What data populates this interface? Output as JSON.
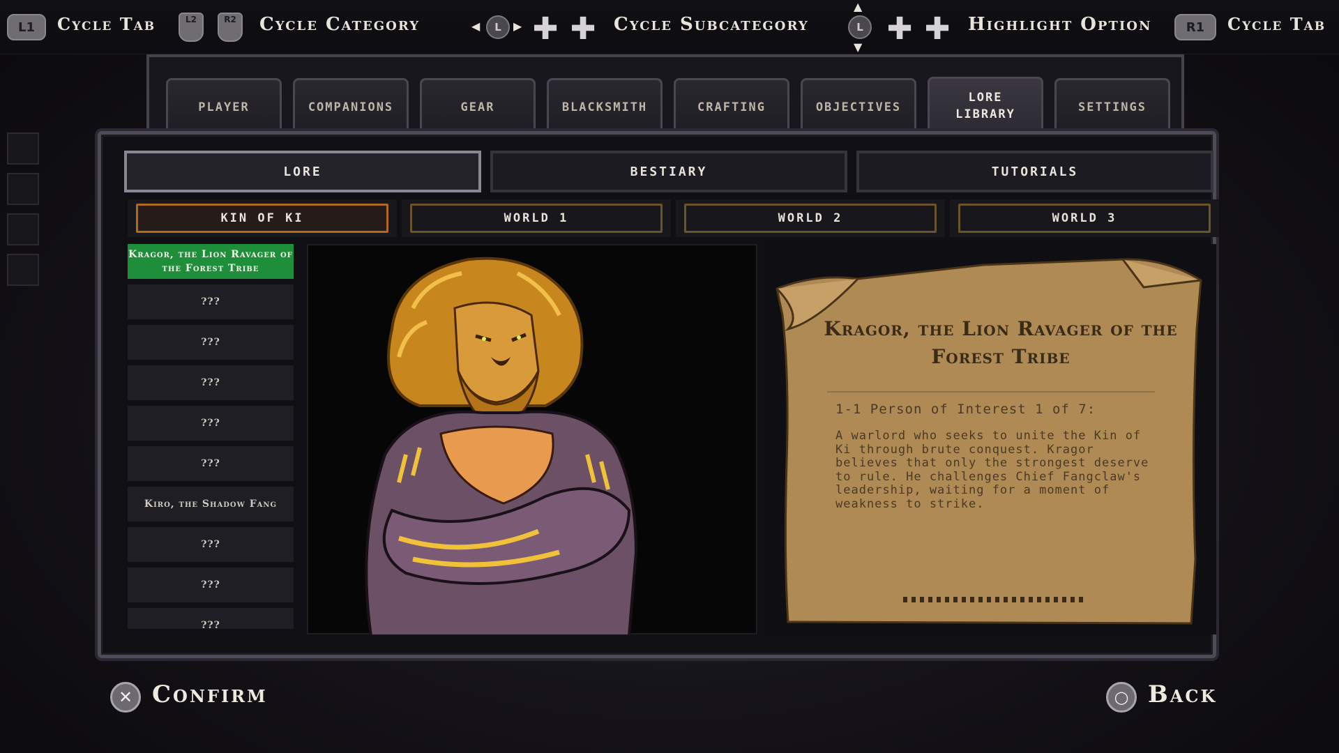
{
  "hints": {
    "l1": "L1",
    "cycle_tab_left": "Cycle Tab",
    "l2": "L2",
    "r2": "R2",
    "cycle_category": "Cycle Category",
    "stick_l": "L",
    "cycle_subcategory": "Cycle Subcategory",
    "highlight_option": "Highlight Option",
    "r1": "R1",
    "cycle_tab_right": "Cycle Tab"
  },
  "tabs": [
    {
      "label": "PLAYER"
    },
    {
      "label": "COMPANIONS"
    },
    {
      "label": "GEAR"
    },
    {
      "label": "BLACKSMITH"
    },
    {
      "label": "CRAFTING"
    },
    {
      "label": "OBJECTIVES"
    },
    {
      "label": "LORE\nLIBRARY",
      "active": true
    },
    {
      "label": "SETTINGS"
    }
  ],
  "categories": [
    "LORE",
    "BESTIARY",
    "TUTORIALS"
  ],
  "subcategories": [
    "KIN OF KI",
    "WORLD 1",
    "WORLD 2",
    "WORLD 3"
  ],
  "entries": [
    "Kragor, the Lion Ravager of the Forest Tribe",
    "???",
    "???",
    "???",
    "???",
    "???",
    "Kiro, the Shadow Fang",
    "???",
    "???",
    "???"
  ],
  "lore": {
    "title": "Kragor, the Lion Ravager of the Forest Tribe",
    "subtitle": "1-1 Person of Interest 1 of 7:",
    "body": "A warlord who seeks to unite the Kin of Ki through brute conquest. Kragor believes that only the strongest deserve to rule. He challenges Chief Fangclaw's leadership, waiting for a moment of weakness to strike."
  },
  "footer": {
    "confirm": "Confirm",
    "back": "Back"
  },
  "colors": {
    "selected_entry": "#1e8e3a",
    "parchment": "#b08a55",
    "subcategory_active": "#b06a1e"
  }
}
